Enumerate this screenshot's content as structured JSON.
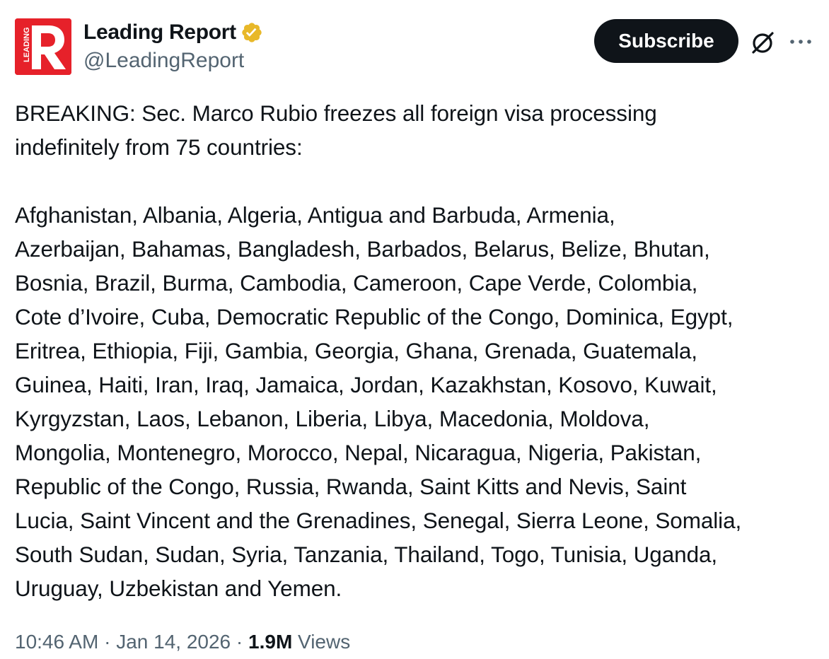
{
  "author": {
    "display_name": "Leading Report",
    "handle": "@LeadingReport",
    "avatar": {
      "letter": "R",
      "side_text": "LEADING",
      "background": "#e6212a"
    },
    "verified_badge_color": "#e8b829"
  },
  "actions": {
    "subscribe_label": "Subscribe",
    "grok_icon": "grok-icon",
    "more_icon": "more-horizontal-icon"
  },
  "tweet": {
    "text": "BREAKING: Sec. Marco Rubio freezes all foreign visa processing\nindefinitely from 75 countries:\n\nAfghanistan, Albania, Algeria, Antigua and Barbuda, Armenia,\nAzerbaijan, Bahamas, Bangladesh, Barbados, Belarus, Belize, Bhutan,\nBosnia, Brazil, Burma, Cambodia, Cameroon, Cape Verde, Colombia,\nCote d’Ivoire, Cuba, Democratic Republic of the Congo, Dominica, Egypt,\nEritrea, Ethiopia, Fiji, Gambia, Georgia, Ghana, Grenada, Guatemala,\nGuinea, Haiti, Iran, Iraq, Jamaica, Jordan, Kazakhstan, Kosovo, Kuwait,\nKyrgyzstan, Laos, Lebanon, Liberia, Libya, Macedonia, Moldova,\nMongolia, Montenegro, Morocco, Nepal, Nicaragua, Nigeria, Pakistan,\nRepublic of the Congo, Russia, Rwanda, Saint Kitts and Nevis, Saint\nLucia, Saint Vincent and the Grenadines, Senegal, Sierra Leone, Somalia,\nSouth Sudan, Sudan, Syria, Tanzania, Thailand, Togo, Tunisia, Uganda,\nUruguay, Uzbekistan and Yemen."
  },
  "meta": {
    "time": "10:46 AM",
    "separator": " · ",
    "date": "Jan 14, 2026",
    "views_count": "1.9M",
    "views_label": " Views"
  },
  "colors": {
    "text_primary": "#0f1419",
    "text_secondary": "#536471",
    "button_bg": "#0f1419"
  }
}
